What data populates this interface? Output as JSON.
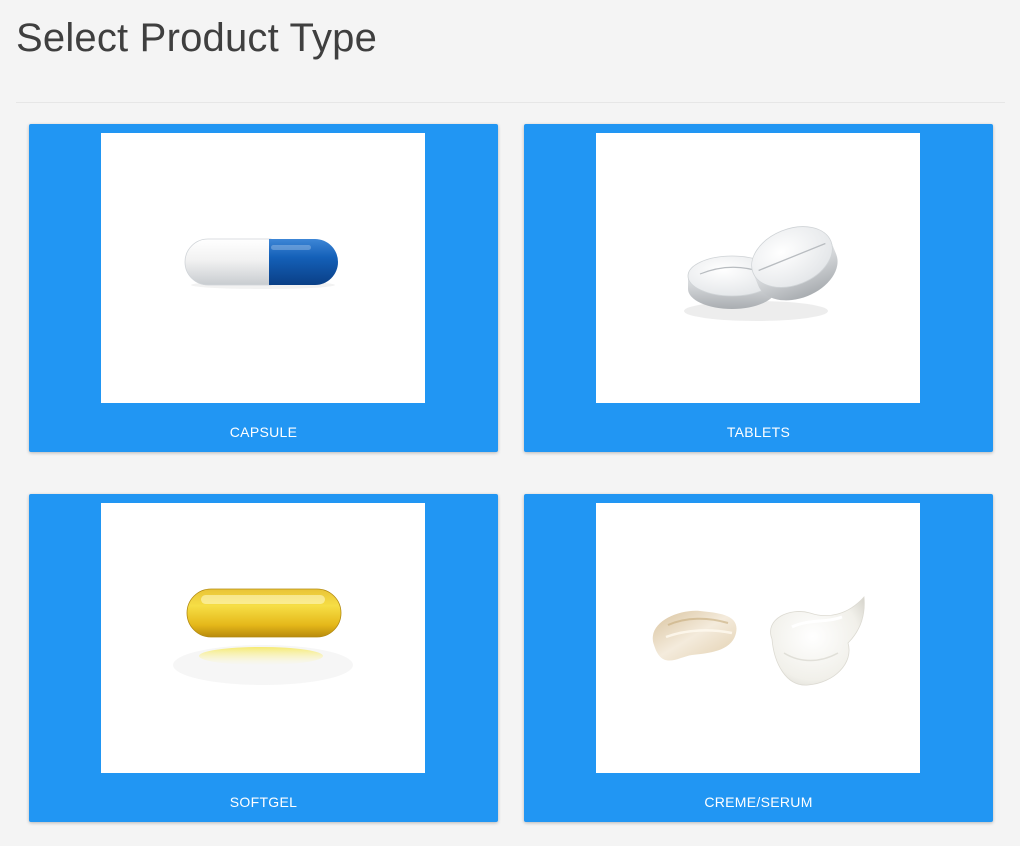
{
  "page": {
    "title": "Select Product Type"
  },
  "colors": {
    "background": "#f4f4f4",
    "card": "#2196f3",
    "title": "#3f3f3f"
  },
  "products": [
    {
      "label": "CAPSULE",
      "icon": "capsule-icon"
    },
    {
      "label": "TABLETS",
      "icon": "tablets-icon"
    },
    {
      "label": "SOFTGEL",
      "icon": "softgel-icon"
    },
    {
      "label": "CREME/SERUM",
      "icon": "creme-serum-icon"
    }
  ]
}
